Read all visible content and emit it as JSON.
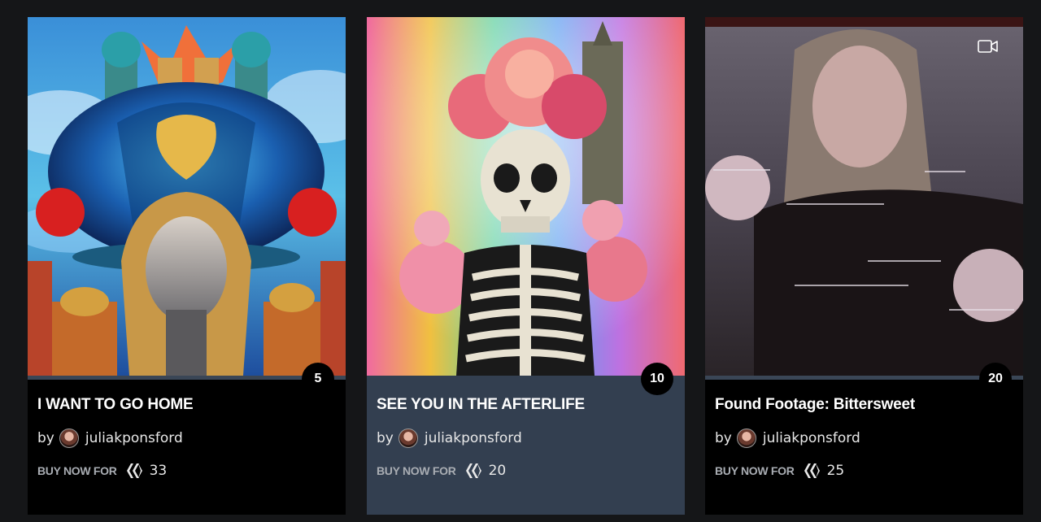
{
  "cards": [
    {
      "title": "I WANT TO GO HOME",
      "count": "5",
      "by_label": "by",
      "author": "juliakponsford",
      "buy_label": "BUY NOW FOR",
      "price": "33",
      "media_type": "image",
      "icon": "hive-icon"
    },
    {
      "title": "SEE YOU IN THE AFTERLIFE",
      "count": "10",
      "by_label": "by",
      "author": "juliakponsford",
      "buy_label": "BUY NOW FOR",
      "price": "20",
      "media_type": "image",
      "icon": "hive-icon"
    },
    {
      "title": "Found Footage: Bittersweet",
      "count": "20",
      "by_label": "by",
      "author": "juliakponsford",
      "buy_label": "BUY NOW FOR",
      "price": "25",
      "media_type": "video",
      "icon": "hive-icon"
    }
  ],
  "colors": {
    "page_bg": "#151618",
    "card_bg": "#000000",
    "card_active_bg": "#333f50",
    "buy_label": "#a9adb3"
  }
}
